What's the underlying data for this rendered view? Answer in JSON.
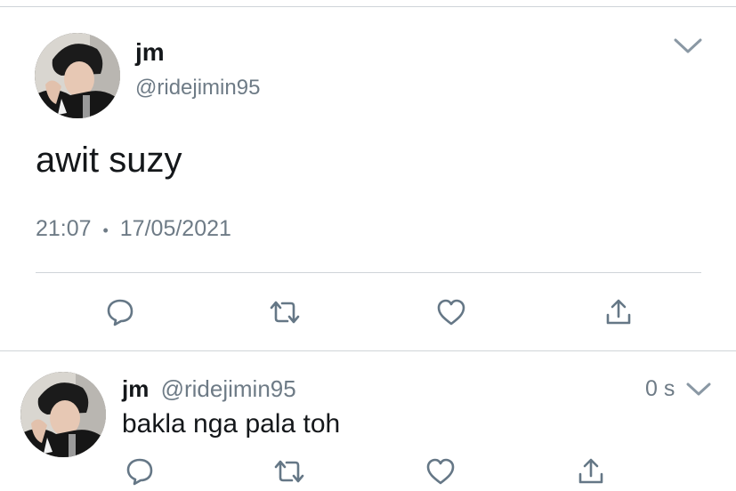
{
  "main_tweet": {
    "display_name": "jm",
    "handle": "@ridejimin95",
    "text": "awit suzy",
    "time": "21:07",
    "separator": "•",
    "date": "17/05/2021"
  },
  "reply": {
    "display_name": "jm",
    "handle": "@ridejimin95",
    "text": "bakla nga pala toh",
    "age": "0 s"
  },
  "icons": {
    "reply": "reply-bubble-icon",
    "retweet": "retweet-icon",
    "like": "heart-icon",
    "share": "share-icon",
    "menu": "chevron-down-icon"
  },
  "colors": {
    "text": "#14171a",
    "secondary": "#6e7b86",
    "icon": "#657786",
    "divider": "#cfd4d8"
  }
}
